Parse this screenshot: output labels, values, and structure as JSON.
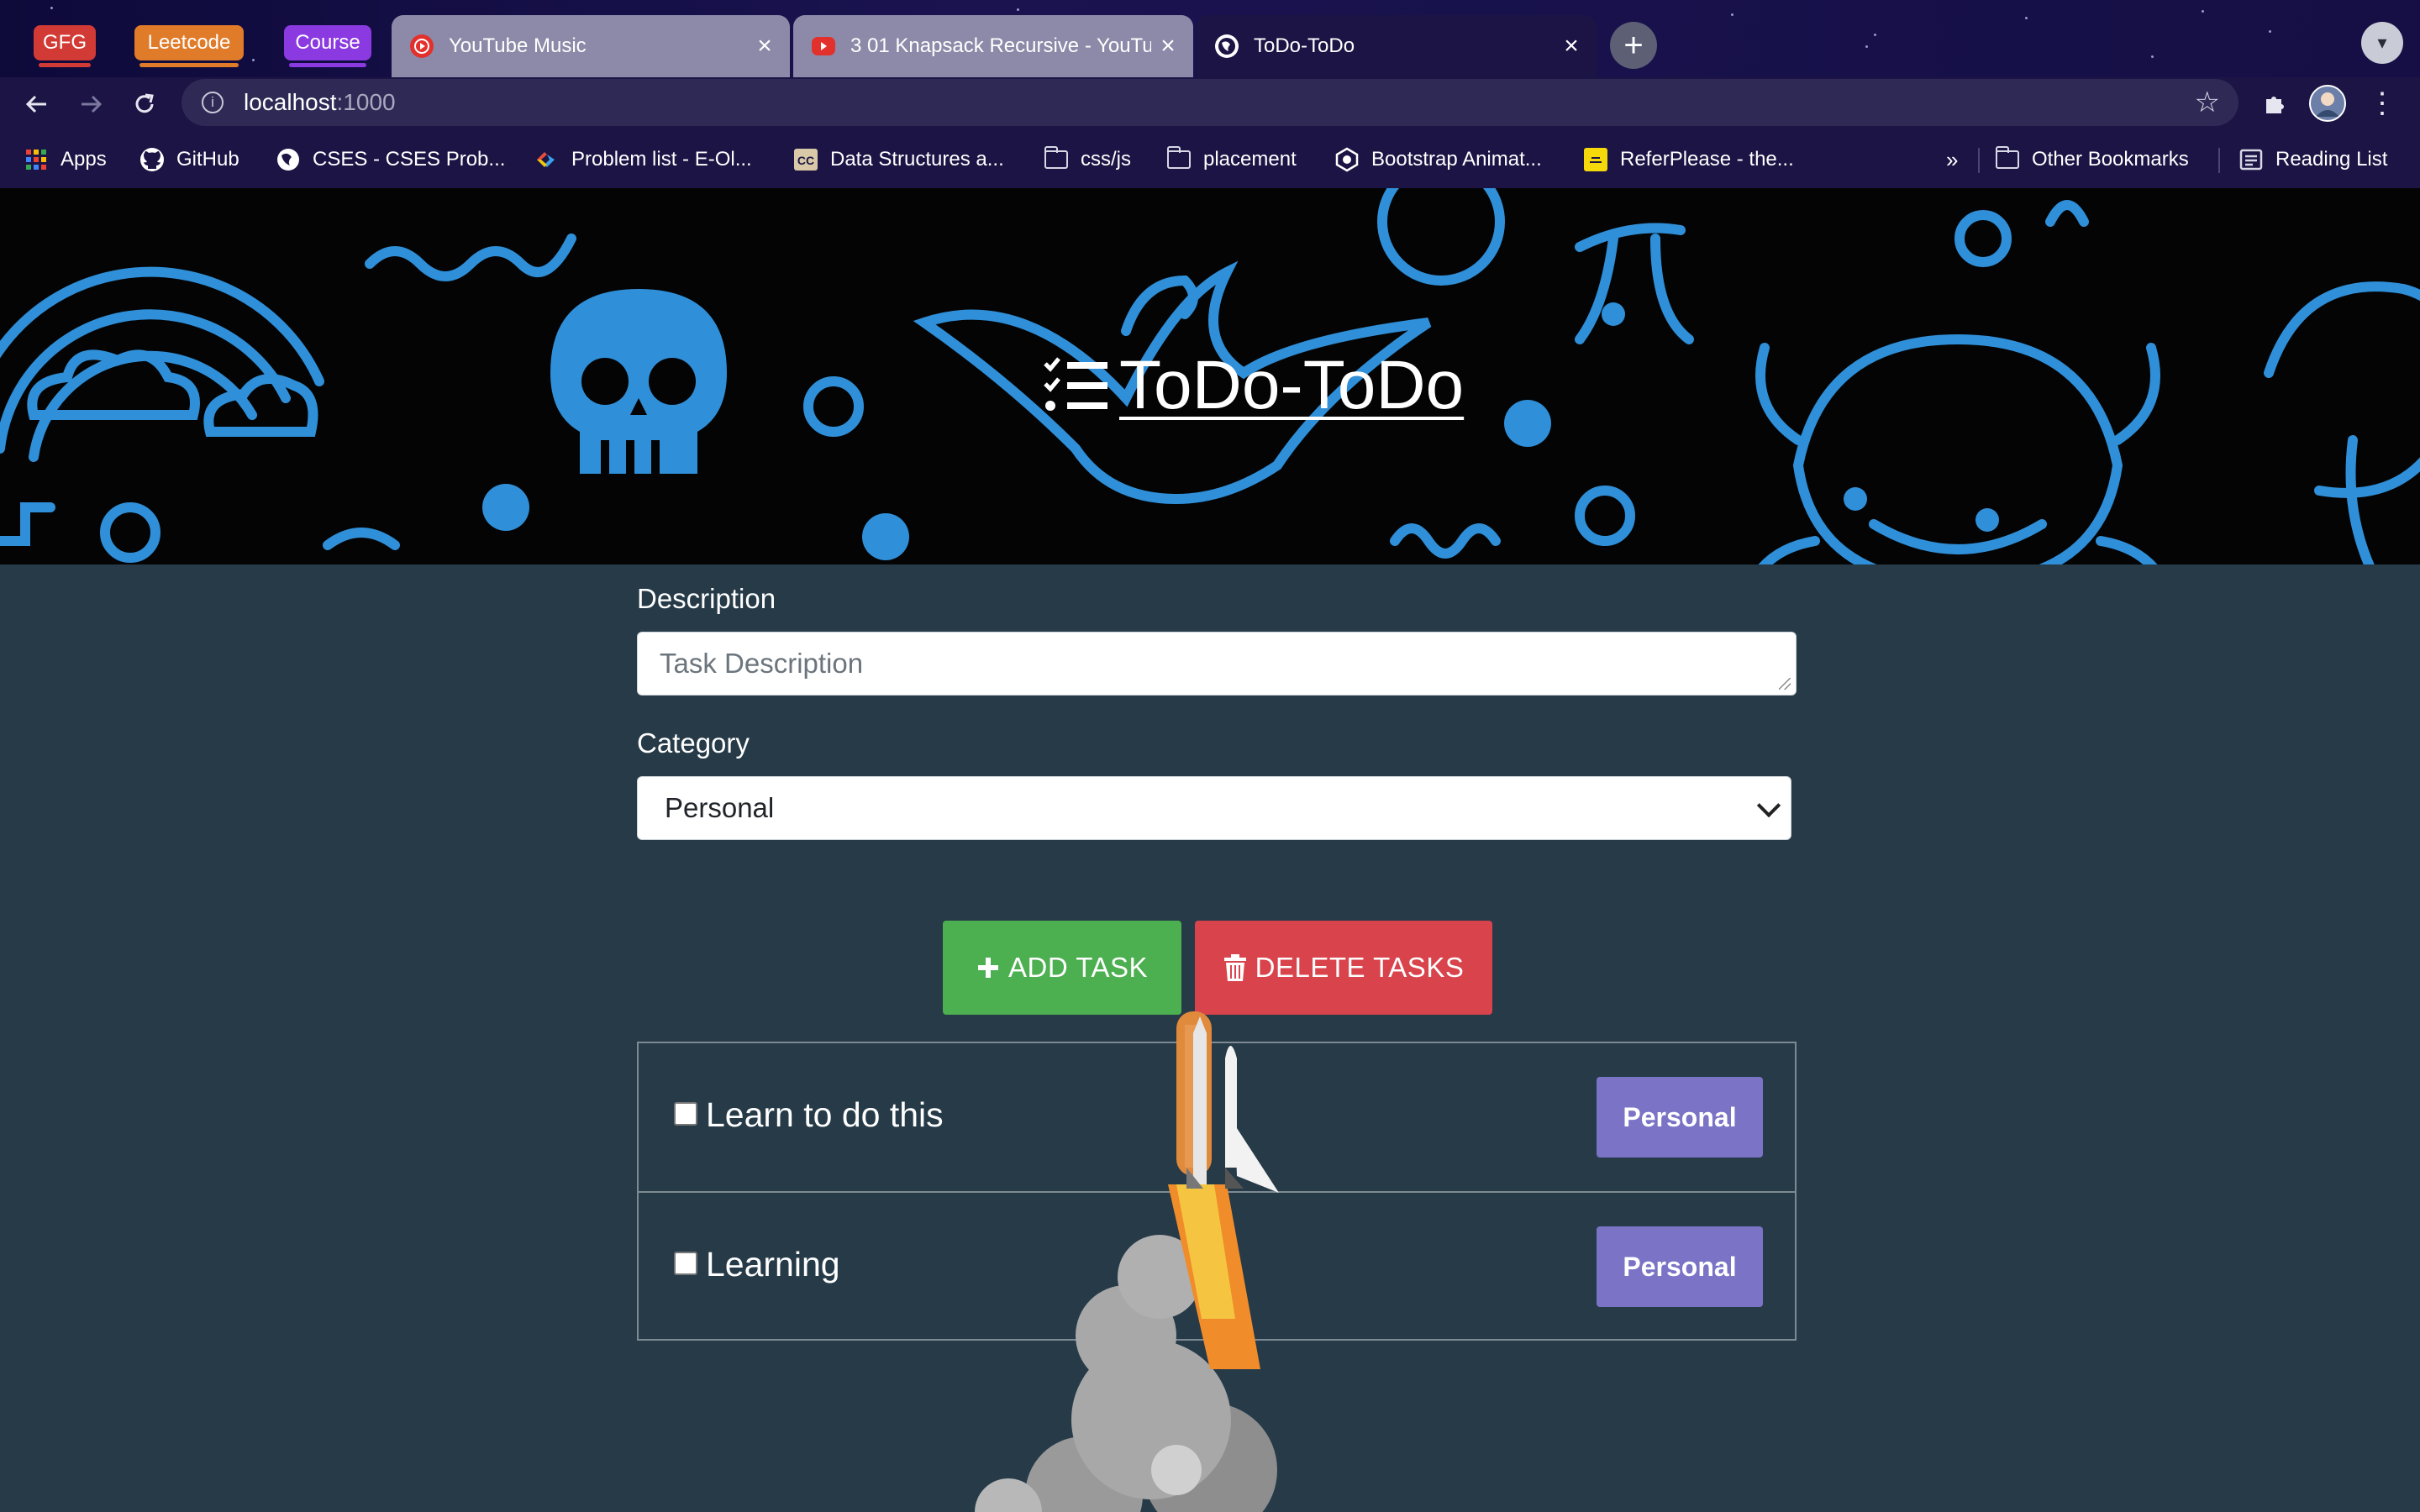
{
  "browser": {
    "tab_groups": [
      {
        "label": "GFG",
        "color": "#d23a35"
      },
      {
        "label": "Leetcode",
        "color": "#e07b2a"
      },
      {
        "label": "Course",
        "color": "#8a3ae0"
      }
    ],
    "tabs": [
      {
        "title": "YouTube Music",
        "favicon": "youtube-music-icon",
        "active": false
      },
      {
        "title": "3 01 Knapsack Recursive - YouTube",
        "favicon": "youtube-icon",
        "active": false
      },
      {
        "title": "ToDo-ToDo",
        "favicon": "globe-icon",
        "active": true
      }
    ],
    "url_host": "localhost",
    "url_port": ":1000",
    "bookmarks": [
      {
        "label": "Apps",
        "icon": "apps-grid-icon"
      },
      {
        "label": "GitHub",
        "icon": "github-icon"
      },
      {
        "label": "CSES - CSES Prob...",
        "icon": "globe-icon"
      },
      {
        "label": "Problem list - E-Ol...",
        "icon": "eolymp-icon"
      },
      {
        "label": "Data Structures a...",
        "icon": "cc-icon"
      },
      {
        "label": "css/js",
        "icon": "folder-icon"
      },
      {
        "label": "placement",
        "icon": "folder-icon"
      },
      {
        "label": "Bootstrap Animat...",
        "icon": "bootstrap-icon"
      },
      {
        "label": "ReferPlease - the...",
        "icon": "referplease-icon"
      }
    ],
    "overflow_label": "»",
    "other_bookmarks": "Other Bookmarks",
    "reading_list": "Reading List"
  },
  "page": {
    "brand_title": "ToDo-ToDo",
    "description_label": "Description",
    "description_placeholder": "Task Description",
    "category_label": "Category",
    "category_selected": "Personal",
    "add_button": "ADD TASK",
    "delete_button": "DELETE TASKS",
    "tasks": [
      {
        "text": "Learn to do this",
        "category": "Personal",
        "checked": false
      },
      {
        "text": "Learning",
        "category": "Personal",
        "checked": false
      }
    ]
  },
  "colors": {
    "add_button": "#4caf50",
    "delete_button": "#d9434b",
    "badge": "#7a73c6",
    "background": "#263a48",
    "hero_doodles": "#2f8fd8"
  }
}
